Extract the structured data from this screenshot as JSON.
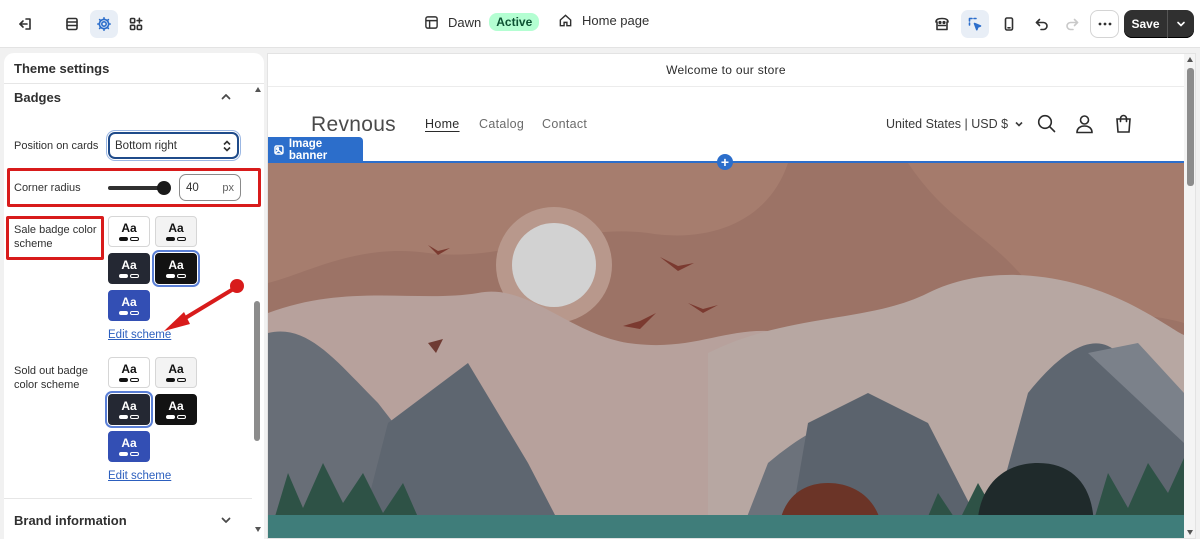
{
  "topbar": {
    "theme_name": "Dawn",
    "theme_status": "Active",
    "page_name": "Home page",
    "save_label": "Save"
  },
  "panel": {
    "title": "Theme settings",
    "badges_heading": "Badges",
    "position_label": "Position on cards",
    "position_value": "Bottom right",
    "corner_radius_label": "Corner radius",
    "corner_radius_value": "40",
    "corner_radius_unit": "px",
    "corner_radius_level": 40,
    "sale_badge_label": "Sale badge color scheme",
    "sold_out_label": "Sold out badge color scheme",
    "swatch_text": "Aa",
    "edit_scheme": "Edit scheme",
    "brand_heading": "Brand information"
  },
  "preview": {
    "announcement": "Welcome to our store",
    "store_name": "Revnous",
    "nav": [
      "Home",
      "Catalog",
      "Contact"
    ],
    "region": "United States | USD $",
    "section_label": "Image banner",
    "plus": "+"
  },
  "colors": {
    "accent": "#2c6ecb",
    "annotation_red": "#d81b1b",
    "active_badge_bg": "#b4fed2",
    "sky": "#9c7366",
    "mountain": "#5e6670",
    "water": "#3f7d7a"
  }
}
